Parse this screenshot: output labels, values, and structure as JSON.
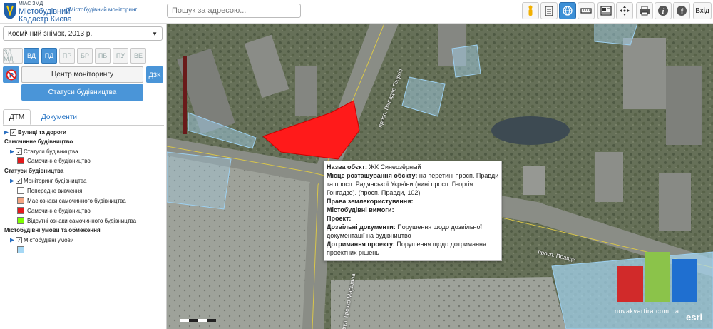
{
  "header": {
    "brand_small": "МІАС ЗМД",
    "brand_line1": "Містобудівний",
    "brand_line2": "Кадастр Києва",
    "subtitle": "Містобудівний моніторинг",
    "search_placeholder": "Пошук за адресою...",
    "login_label": "Вхід",
    "tool_icons": [
      "person-icon",
      "clipboard-icon",
      "globe-icon",
      "ruler-icon",
      "print-layout-icon",
      "crosshair-icon",
      "printer-icon",
      "info-icon",
      "facebook-icon"
    ]
  },
  "sidebar": {
    "basemap_select": "Космічний знімок, 2013 р.",
    "layer_buttons": [
      {
        "label": "ЗД МД",
        "active": false
      },
      {
        "label": "ВД",
        "active": true
      },
      {
        "label": "ПД",
        "active": true
      },
      {
        "label": "ПР",
        "active": false
      },
      {
        "label": "БР",
        "active": false
      },
      {
        "label": "ПБ",
        "active": false
      },
      {
        "label": "ПУ",
        "active": false
      },
      {
        "label": "ВЕ",
        "active": false
      }
    ],
    "center_button": "Центр моніторингу",
    "dzk_button": "ДЗК",
    "status_button": "Статуси будівництва",
    "tabs": [
      "ДТМ",
      "Документи"
    ],
    "tree": {
      "streets": "Вулиці та дороги",
      "samochynne_group": "Самочинне будівництво",
      "samochynne_sub": "Статуси будівництва",
      "samochynne_item": "Самочинне будівництво",
      "statusy_group": "Статуси будівництва",
      "monitoring": "Моніторинг будівництва",
      "item1": "Попереднє вивчення",
      "item2": "Має ознаки самочинного будівництва",
      "item3": "Самочинне будівництво",
      "item4": "Відсутні ознаки самочинного будівництва",
      "mistobud_group": "Містобудівні умови та обмеження",
      "mistobud_item": "Містобудівні умови"
    },
    "colors": {
      "red": "#e41a1c",
      "white": "#ffffff",
      "salmon": "#f4a582",
      "green": "#7fff00",
      "lightblue": "#a6d8f5"
    }
  },
  "popup": {
    "name_label": "Назва обєкт:",
    "name_value": "ЖК Синеозёрный",
    "location_label": "Місце розташування обєкту:",
    "location_value": "на перетині просп. Правди та просп. Радянської України (нині просп. Георгія Гонгадзе). (просп. Правди, 102)",
    "land_label": "Права землекористування:",
    "requirements_label": "Містобудівні вимоги:",
    "project_label": "Проект:",
    "permits_label": "Дозвільні документи:",
    "permits_value": "Порушення щодо дозвільної документації на будівництво",
    "compliance_label": "Дотримання проекту:",
    "compliance_value": "Порушення щодо дотримання проектних рішень"
  },
  "map": {
    "street1": "просп. Гонгадзе Георгія",
    "street2": "просп. Правди",
    "street3": "вул. Гречко Маршала",
    "watermark": "novakvartira.com.ua",
    "esri": "esri"
  }
}
